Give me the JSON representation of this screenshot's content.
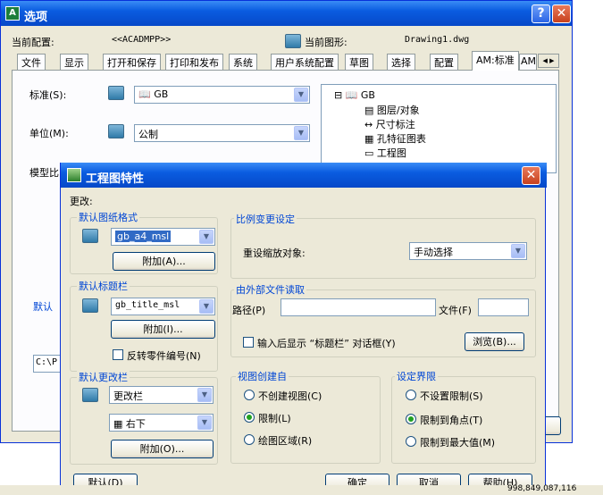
{
  "window": {
    "title": "选项",
    "help_label": "?",
    "close_label": "✕",
    "current_profile_label": "当前配置:",
    "current_profile_value": "<<ACADMPP>>",
    "current_drawing_label": "当前图形:",
    "current_drawing_value": "Drawing1.dwg"
  },
  "tabs": [
    "文件",
    "显示",
    "打开和保存",
    "打印和发布",
    "系统",
    "用户系统配置",
    "草图",
    "选择",
    "配置",
    "AM:标准",
    "AM"
  ],
  "tab_scroll": "◀ ▶",
  "standards": {
    "standard_label": "标准(S):",
    "standard_value": "GB",
    "unit_label": "单位(M):",
    "unit_value": "公制",
    "model_label": "模型比",
    "default_label": "默认",
    "path_value": "C:\\P"
  },
  "tree": {
    "root": "GB",
    "items": [
      "图层/对象",
      "尺寸标注",
      "孔特征图表",
      "工程图",
      "…"
    ]
  },
  "dialog": {
    "title": "工程图特性",
    "close_label": "✕",
    "change_label": "更改:",
    "sheet_format": {
      "legend": "默认图纸格式",
      "value": "gb_a4_msl",
      "add_button": "附加(A)..."
    },
    "title_block": {
      "legend": "默认标题栏",
      "value": "gb_title_msl",
      "add_button": "附加(I)...",
      "reverse_label": "反转零件编号(N)"
    },
    "revision": {
      "legend": "默认更改栏",
      "value": "更改栏",
      "position": "右下",
      "add_button": "附加(O)..."
    },
    "scale": {
      "legend": "比例变更设定",
      "rescale_label": "重设缩放对象:",
      "rescale_value": "手动选择"
    },
    "external": {
      "legend": "由外部文件读取",
      "path_label": "路径(P)",
      "path_value": "",
      "file_label": "文件(F)",
      "file_value": "",
      "show_dialog_label": "输入后显示 “标题栏” 对话框(Y)",
      "browse_button": "浏览(B)..."
    },
    "view_create": {
      "legend": "视图创建自",
      "options": [
        "不创建视图(C)",
        "限制(L)",
        "绘图区域(R)"
      ],
      "selected_index": 1
    },
    "limits": {
      "legend": "设定界限",
      "options": [
        "不设置限制(S)",
        "限制到角点(T)",
        "限制到最大值(M)"
      ],
      "selected_index": 1
    },
    "buttons": {
      "default": "默认(D)",
      "ok": "确定",
      "cancel": "取消",
      "help": "帮助(H)"
    }
  },
  "taskbar": {
    "text": "998,849,087,116"
  }
}
